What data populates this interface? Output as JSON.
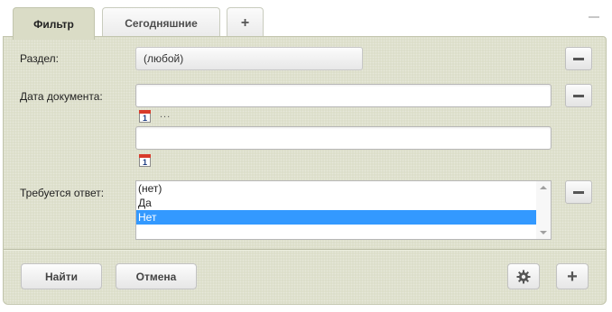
{
  "tabs": [
    {
      "label": "Фильтр",
      "active": true
    },
    {
      "label": "Сегодняшние",
      "active": false
    }
  ],
  "tab_add_symbol": "+",
  "filter": {
    "section_label": "Раздел:",
    "section_value": "(любой)",
    "date_label": "Дата документа:",
    "date_from_value": "",
    "date_to_value": "",
    "date_range_separator": "...",
    "calendar_day": "1",
    "reply_label": "Требуется ответ:",
    "reply_options": [
      {
        "label": "(нет)",
        "selected": false
      },
      {
        "label": "Да",
        "selected": false
      },
      {
        "label": "Нет",
        "selected": true
      }
    ]
  },
  "actions": {
    "find_label": "Найти",
    "cancel_label": "Отмена",
    "add_symbol": "+"
  },
  "icons": {
    "settings": "gear-icon",
    "add": "plus-icon",
    "remove": "minus-icon",
    "calendar": "calendar-icon",
    "collapse": "collapse-icon"
  },
  "colors": {
    "panel_background": "#dadcc6",
    "selected_option": "#3399ff",
    "calendar_header": "#d83a2a"
  }
}
